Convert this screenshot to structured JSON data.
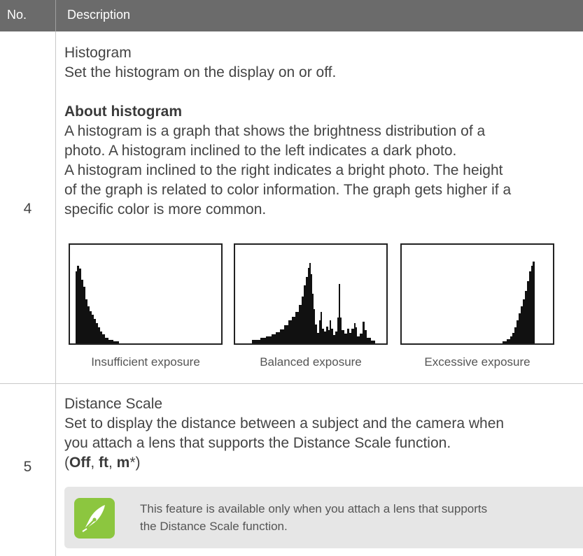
{
  "header": {
    "no_label": "No.",
    "description_label": "Description"
  },
  "row4": {
    "number": "4",
    "title": "Histogram",
    "desc": "Set the histogram on the display on or off.",
    "about_heading": "About histogram",
    "about_lines": [
      "A histogram is a graph that shows the brightness distribution of a",
      "photo. A histogram inclined to the left indicates a dark photo.",
      "A histogram inclined to the right indicates a bright photo. The height",
      "of the graph is related to color information. The graph gets higher if a",
      "specific color is more common."
    ],
    "histograms": [
      {
        "caption": "Insufficient exposure",
        "shape": "left-skewed"
      },
      {
        "caption": "Balanced exposure",
        "shape": "centered"
      },
      {
        "caption": "Excessive exposure",
        "shape": "right-skewed"
      }
    ]
  },
  "row5": {
    "number": "5",
    "title": "Distance Scale",
    "desc_lines": [
      "Set to display the distance between a subject and the camera when",
      "you attach a lens that supports the Distance Scale function."
    ],
    "options": {
      "open": "(",
      "off": "Off",
      "sep1": ", ",
      "ft": "ft",
      "sep2": ", ",
      "m": "m",
      "star": "*",
      "close": ")"
    },
    "note": {
      "icon": "pen-note-icon",
      "lines": [
        "This feature is available only when you attach a lens that supports",
        "the Distance Scale function."
      ]
    }
  },
  "colors": {
    "header_bg": "#6b6b6b",
    "note_bg": "#e6e6e6",
    "icon_accent": "#8cc63f"
  }
}
